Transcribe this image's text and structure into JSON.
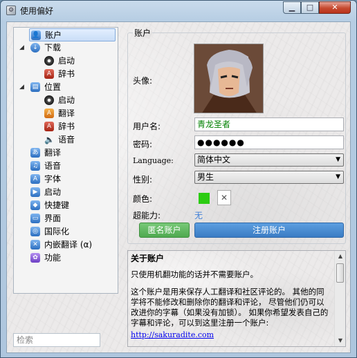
{
  "window": {
    "title": "使用偏好"
  },
  "sidebar": {
    "items": [
      {
        "label": "账户",
        "icon": "user-icon",
        "selected": true
      },
      {
        "label": "下载",
        "icon": "download-icon",
        "expanded": true
      },
      {
        "label": "启动",
        "icon": "launch-icon"
      },
      {
        "label": "辞书",
        "icon": "dictionary-icon"
      },
      {
        "label": "位置",
        "icon": "location-icon",
        "expanded": true
      },
      {
        "label": "启动",
        "icon": "launch-icon"
      },
      {
        "label": "翻译",
        "icon": "translate-icon"
      },
      {
        "label": "辞书",
        "icon": "dictionary-icon"
      },
      {
        "label": "语音",
        "icon": "speaker-icon"
      },
      {
        "label": "翻译",
        "icon": "translate-icon"
      },
      {
        "label": "语音",
        "icon": "voice-icon"
      },
      {
        "label": "字体",
        "icon": "font-icon"
      },
      {
        "label": "启动",
        "icon": "launch-icon"
      },
      {
        "label": "快捷键",
        "icon": "shortcut-icon"
      },
      {
        "label": "界面",
        "icon": "ui-icon"
      },
      {
        "label": "国际化",
        "icon": "globe-icon"
      },
      {
        "label": "内嵌翻译 (α)",
        "icon": "embed-translate-icon"
      },
      {
        "label": "功能",
        "icon": "feature-icon"
      }
    ],
    "search_placeholder": "检索"
  },
  "account": {
    "group_title": "账户",
    "avatar_label": "头像:",
    "username_label": "用户名:",
    "username_value": "青龙圣者",
    "password_label": "密码:",
    "password_value": "●●●●●●",
    "language_label": "Language:",
    "language_value": "简体中文",
    "gender_label": "性别:",
    "gender_value": "男生",
    "color_label": "颜色:",
    "color_value": "#2ccc12",
    "clear_symbol": "✕",
    "power_label": "超能力:",
    "power_value": "无",
    "anon_button": "匿名账户",
    "register_button": "注册账户"
  },
  "about": {
    "title": "关于账户",
    "p1": "只使用机翻功能的话并不需要账户。",
    "p2": "这个账户是用来保存人工翻译和社区评论的。 其他的同学将不能修改和删除你的翻译和评论， 尽管他们仍可以改进你的字幕（如果没有加锁）。 如果你希望发表自己的字幕和评论，可以到这里注册一个账户:",
    "link": "http://sakuradite.com"
  }
}
